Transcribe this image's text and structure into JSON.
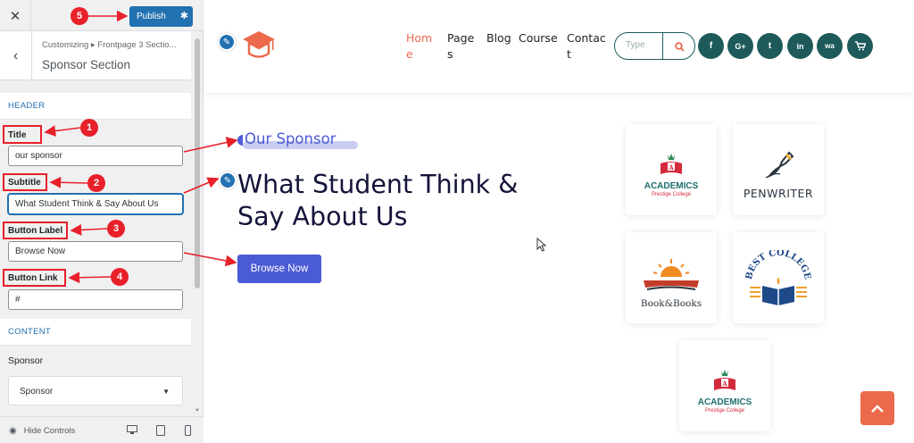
{
  "customizer": {
    "close_icon": "✕",
    "publish_label": "Publish",
    "breadcrumb": "Customizing ▸ Frontpage 3 Sectio...",
    "section_title": "Sponsor Section",
    "header_group": "HEADER",
    "fields": {
      "title_label": "Title",
      "title_value": "our sponsor",
      "subtitle_label": "Subtitle",
      "subtitle_value": "What Student Think & Say About Us",
      "button_label_label": "Button Label",
      "button_label_value": "Browse Now",
      "button_link_label": "Button Link",
      "button_link_value": "#"
    },
    "content_group": "CONTENT",
    "sponsor_label": "Sponsor",
    "sponsor_select": "Sponsor",
    "hide_controls": "Hide Controls"
  },
  "markers": [
    "1",
    "2",
    "3",
    "4",
    "5"
  ],
  "site": {
    "nav": [
      "Home",
      "Pages",
      "Blog",
      "Course",
      "Contact"
    ],
    "search_placeholder": "Type",
    "social_icons": [
      "f",
      "G+",
      "t",
      "in",
      "wa"
    ],
    "cart_count": "0",
    "section": {
      "eyebrow": "Our Sponsor",
      "headline": "What Student Think & Say About Us",
      "button": "Browse Now"
    },
    "sponsors": [
      {
        "name": "ACADEMICS",
        "tagline": "Prestige College"
      },
      {
        "name": "PENWRITER",
        "tagline": ""
      },
      {
        "name": "Book&Books",
        "tagline": ""
      },
      {
        "name": "BEST COLLEGE",
        "tagline": ""
      },
      {
        "name": "ACADEMICS",
        "tagline": "Prestige College"
      }
    ]
  },
  "colors": {
    "wp_blue": "#2271b1",
    "accent": "#ea6a4b",
    "teal": "#1e5a5a",
    "indigo": "#4b5bd6",
    "annotation_red": "#e8202a"
  }
}
